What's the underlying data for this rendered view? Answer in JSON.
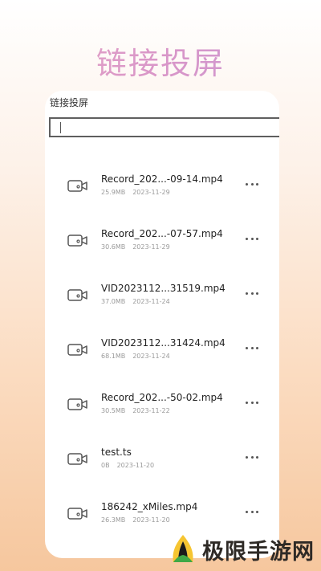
{
  "hero": {
    "title": "链接投屏"
  },
  "card": {
    "title": "链接投屏"
  },
  "search": {
    "value": "",
    "placeholder": ""
  },
  "files": [
    {
      "name": "Record_202...-09-14.mp4",
      "size": "25.9MB",
      "date": "2023-11-29"
    },
    {
      "name": "Record_202...-07-57.mp4",
      "size": "30.6MB",
      "date": "2023-11-29"
    },
    {
      "name": "VID2023112...31519.mp4",
      "size": "37.0MB",
      "date": "2023-11-24"
    },
    {
      "name": "VID2023112...31424.mp4",
      "size": "68.1MB",
      "date": "2023-11-24"
    },
    {
      "name": "Record_202...-50-02.mp4",
      "size": "30.5MB",
      "date": "2023-11-22"
    },
    {
      "name": "test.ts",
      "size": "0B",
      "date": "2023-11-20"
    },
    {
      "name": "186242_xMiles.mp4",
      "size": "26.3MB",
      "date": "2023-11-20"
    }
  ],
  "watermark": {
    "text": "极限手游网"
  },
  "colors": {
    "accent": "#d996c8",
    "icon": "#555555",
    "meta": "#9a9a9a"
  },
  "icons": {
    "file": "video-camera-icon",
    "more": "more-horizontal-icon",
    "logo": "leaf-logo-icon"
  }
}
